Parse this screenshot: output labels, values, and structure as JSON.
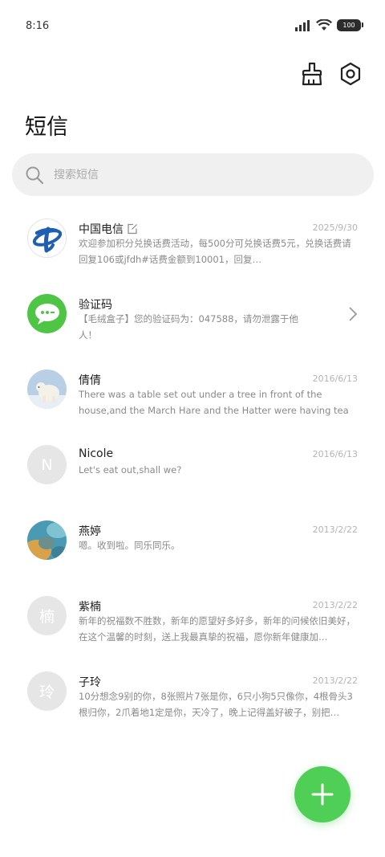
{
  "status_bar": {
    "time": "8:16",
    "battery": "100"
  },
  "header": {
    "title": "短信"
  },
  "search": {
    "placeholder": "搜索短信"
  },
  "conversations": [
    {
      "name": "中国电信",
      "date": "2025/9/30",
      "preview": "欢迎参加积分兑换话费活动，每500分可兑换话费5元，兑换话费请回复106或jfdh#话费金额到10001，回复…",
      "avatar": "china-telecom-logo"
    },
    {
      "name": "验证码",
      "date": "",
      "preview": "【毛绒盒子】您的验证码为：047588，请勿泄露于他人！",
      "avatar": "message-bubble"
    },
    {
      "name": "倩倩",
      "date": "2016/6/13",
      "preview": "There was a table set out under a tree in front of the house,and the March Hare and the Hatter were having tea at it.",
      "avatar": "polar-bear-photo"
    },
    {
      "name": "Nicole",
      "date": "2016/6/13",
      "preview": "Let's eat out,shall we?",
      "avatar_letter": "N"
    },
    {
      "name": "燕婷",
      "date": "2013/2/22",
      "preview": "嗯。收到啦。同乐同乐。",
      "avatar": "landscape-photo"
    },
    {
      "name": "紫楠",
      "date": "2013/2/22",
      "preview": "新年的祝福数不胜数，新年的愿望好多好多，新年的问候依旧美好，在这个温馨的时刻，送上我最真挚的祝福，愿你新年健康加…",
      "avatar_letter": "楠"
    },
    {
      "name": "子玲",
      "date": "2013/2/22",
      "preview": "10分想念9别的你，8张照片7张是你，6只小狗5只像你，4根骨头3根归你，2爪着地1定是你，天冷了，晚上记得盖好被子，别把…",
      "avatar_letter": "玲"
    }
  ],
  "colors": {
    "accent": "#4fcf55",
    "telecom_blue": "#1e5fb4"
  }
}
